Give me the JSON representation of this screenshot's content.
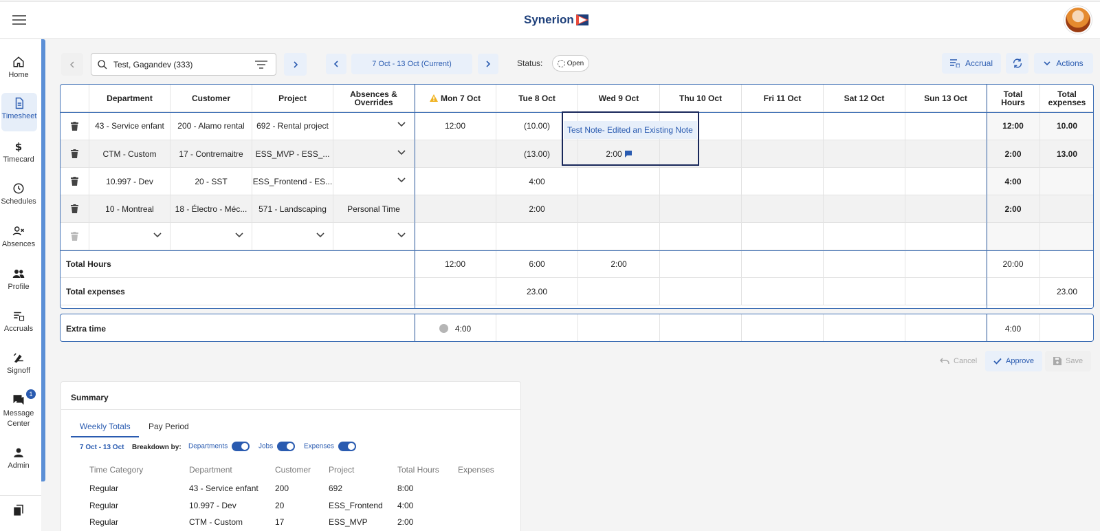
{
  "app": {
    "brand": "Synerion"
  },
  "nav": [
    {
      "label": "Home",
      "icon": "home-icon"
    },
    {
      "label": "Timesheet",
      "icon": "timesheet-icon",
      "active": true
    },
    {
      "label": "Timecard",
      "icon": "dollar-icon"
    },
    {
      "label": "Schedules",
      "icon": "clock-icon"
    },
    {
      "label": "Absences",
      "icon": "person-x-icon"
    },
    {
      "label": "Profile",
      "icon": "people-icon"
    },
    {
      "label": "Accruals",
      "icon": "accruals-icon"
    },
    {
      "label": "Signoff",
      "icon": "signoff-icon"
    },
    {
      "label": "Message Center",
      "icon": "message-icon",
      "badge": "1"
    },
    {
      "label": "Admin",
      "icon": "person-icon"
    }
  ],
  "toolbar": {
    "employee": "Test, Gagandev (333)",
    "period": "7 Oct - 13 Oct (Current)",
    "status_label": "Status:",
    "status_value": "Open",
    "accrual": "Accrual",
    "actions": "Actions"
  },
  "grid": {
    "headers": [
      "Department",
      "Customer",
      "Project",
      "Absences & Overrides",
      "Mon 7 Oct",
      "Tue 8 Oct",
      "Wed 9 Oct",
      "Thu 10 Oct",
      "Fri 11 Oct",
      "Sat 12 Oct",
      "Sun 13 Oct",
      "Total Hours",
      "Total expenses"
    ],
    "headers_split": {
      "absences": [
        "Absences &",
        "Overrides"
      ],
      "total_hours": [
        "Total",
        "Hours"
      ],
      "total_expenses": [
        "Total",
        "expenses"
      ]
    },
    "rows": [
      {
        "dept": "43 - Service enfant",
        "cust": "200 - Alamo rental",
        "proj": "692 - Rental project",
        "abs": "",
        "mon": "12:00",
        "tue": "(10.00)",
        "wed": "",
        "thu": "",
        "fri": "",
        "sat": "",
        "sun": "",
        "hours": "12:00",
        "exp": "10.00"
      },
      {
        "dept": "CTM - Custom",
        "cust": "17 - Contremaitre",
        "proj": "ESS_MVP - ESS_...",
        "abs": "",
        "mon": "",
        "tue": "(13.00)",
        "wed": "2:00",
        "thu": "",
        "fri": "",
        "sat": "",
        "sun": "",
        "hours": "2:00",
        "exp": "13.00"
      },
      {
        "dept": "10.997 - Dev",
        "cust": "20 - SST",
        "proj": "ESS_Frontend - ES...",
        "abs": "",
        "mon": "",
        "tue": "4:00",
        "wed": "",
        "thu": "",
        "fri": "",
        "sat": "",
        "sun": "",
        "hours": "4:00",
        "exp": ""
      },
      {
        "dept": "10 - Montreal",
        "cust": "18 - Électro - Méc...",
        "proj": "571 - Landscaping",
        "abs": "Personal Time",
        "mon": "",
        "tue": "2:00",
        "wed": "",
        "thu": "",
        "fri": "",
        "sat": "",
        "sun": "",
        "hours": "2:00",
        "exp": ""
      }
    ],
    "total_hours": {
      "label": "Total Hours",
      "mon": "12:00",
      "tue": "6:00",
      "wed": "2:00",
      "total": "20:00"
    },
    "total_expenses": {
      "label": "Total expenses",
      "tue": "23.00",
      "total": "23.00"
    },
    "note_text": "Test Note- Edited an Existing Note"
  },
  "extra_time": {
    "label": "Extra time",
    "mon": "4:00",
    "total": "4:00"
  },
  "actions": {
    "cancel": "Cancel",
    "approve": "Approve",
    "save": "Save"
  },
  "summary": {
    "title": "Summary",
    "tabs": [
      "Weekly Totals",
      "Pay Period"
    ],
    "range": "7 Oct - 13 Oct",
    "breakdown_label": "Breakdown by:",
    "toggles": [
      "Departments",
      "Jobs",
      "Expenses"
    ],
    "columns": [
      "Time Category",
      "Department",
      "Customer",
      "Project",
      "Total Hours",
      "Expenses"
    ],
    "rows": [
      [
        "Regular",
        "43 - Service enfant",
        "200",
        "692",
        "8:00",
        ""
      ],
      [
        "Regular",
        "10.997 - Dev",
        "20",
        "ESS_Frontend",
        "4:00",
        ""
      ],
      [
        "Regular",
        "CTM - Custom",
        "17",
        "ESS_MVP",
        "2:00",
        ""
      ]
    ]
  },
  "colors": {
    "accent": "#2a5bb0",
    "border": "#3d6eb4",
    "brand": "#1d3f7a"
  }
}
